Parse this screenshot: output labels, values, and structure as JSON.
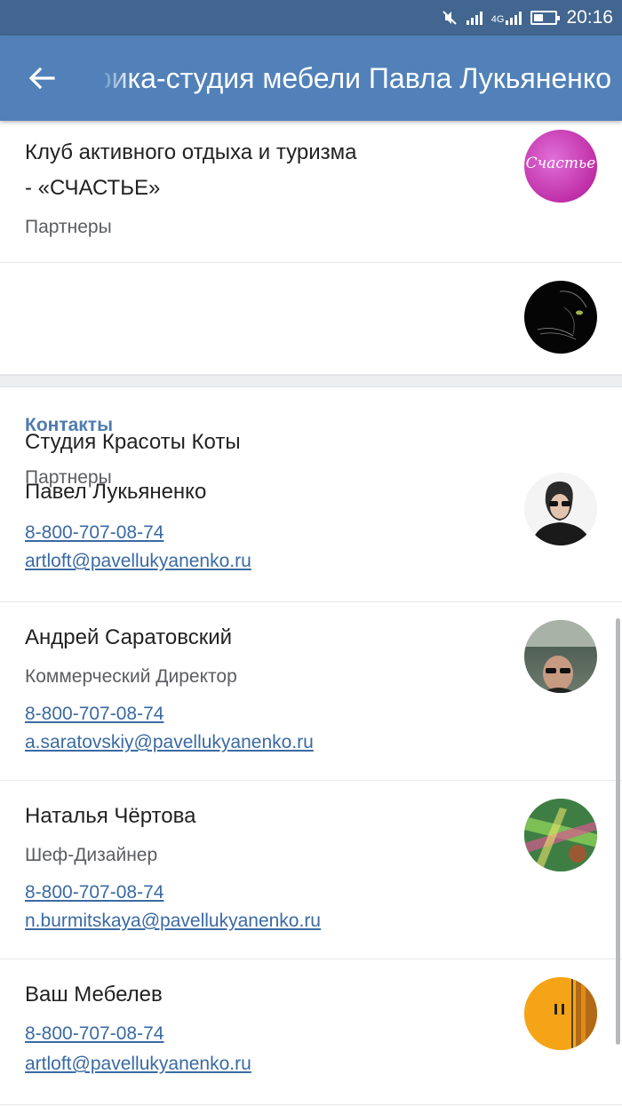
{
  "status_bar": {
    "time": "20:16",
    "network_label": "4G",
    "battery_level": 0.45,
    "icons": [
      "mute-icon",
      "signal-icon",
      "signal-4g-icon",
      "battery-icon"
    ]
  },
  "app_bar": {
    "back_icon": "arrow-left-icon",
    "title": "Фабрика-студия мебели Павла Лукьяненко",
    "color": "#5181b8"
  },
  "groups": [
    {
      "name": "Клуб активного отдыха и туризма - «СЧАСТЬЕ»",
      "subtitle": "Партнеры",
      "avatar_text": "Счастье"
    },
    {
      "name": "Студия Красоты Коты",
      "subtitle": "Партнеры"
    }
  ],
  "contacts_section": {
    "title": "Контакты",
    "items": [
      {
        "name": "Павел Лукьяненко",
        "role": "",
        "phone": "8-800-707-08-74",
        "email": "artloft@pavellukyanenko.ru"
      },
      {
        "name": "Андрей Саратовский",
        "role": "Коммерческий Директор",
        "phone": "8-800-707-08-74",
        "email": "a.saratovskiy@pavellukyanenko.ru"
      },
      {
        "name": "Наталья Чёртова",
        "role": "Шеф-Дизайнер",
        "phone": "8-800-707-08-74",
        "email": "n.burmitskaya@pavellukyanenko.ru"
      },
      {
        "name": "Ваш Мебелев",
        "role": "",
        "phone": "8-800-707-08-74",
        "email": "artloft@pavellukyanenko.ru"
      }
    ]
  },
  "colors": {
    "status_bar": "#42668f",
    "link": "#3a6aa3",
    "section_header": "#4f7cad"
  }
}
